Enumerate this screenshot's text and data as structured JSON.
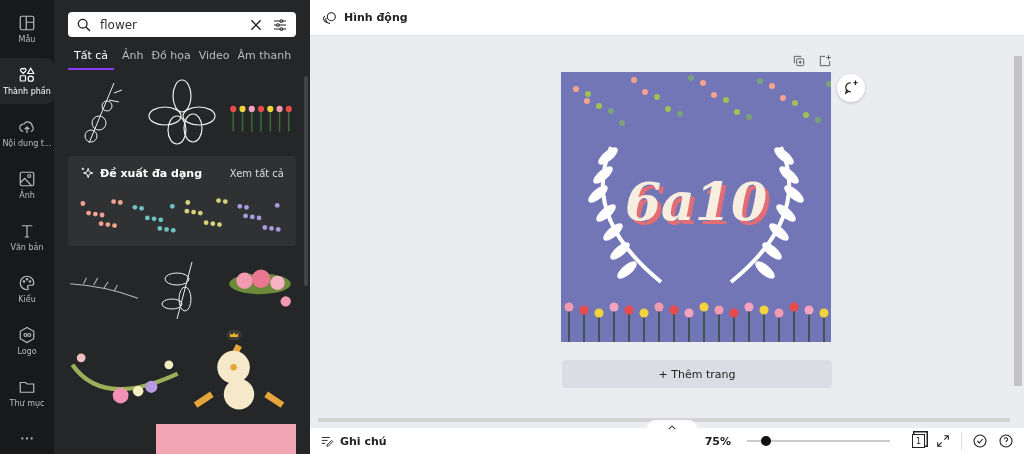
{
  "rail": [
    {
      "label": "Mẫu",
      "selected": false
    },
    {
      "label": "Thành phần",
      "selected": true
    },
    {
      "label": "Nội dung t...",
      "selected": false
    },
    {
      "label": "Ảnh",
      "selected": false
    },
    {
      "label": "Văn bản",
      "selected": false
    },
    {
      "label": "Kiểu",
      "selected": false
    },
    {
      "label": "Logo",
      "selected": false
    },
    {
      "label": "Thư mục",
      "selected": false
    }
  ],
  "search": {
    "value": "flower"
  },
  "tabs": [
    {
      "label": "Tất cả",
      "selected": true
    },
    {
      "label": "Ảnh",
      "selected": false
    },
    {
      "label": "Đồ họa",
      "selected": false
    },
    {
      "label": "Video",
      "selected": false
    },
    {
      "label": "Âm thanh",
      "selected": false
    }
  ],
  "suggestion": {
    "title": "Đề xuất đa dạng",
    "link": "Xem tất cả"
  },
  "toolbar": {
    "label": "Hình động"
  },
  "design": {
    "text": "6a10"
  },
  "add_page": "+ Thêm trang",
  "footer": {
    "notes": "Ghi chú",
    "zoom": "75%",
    "level": 0.13,
    "page": "1"
  }
}
